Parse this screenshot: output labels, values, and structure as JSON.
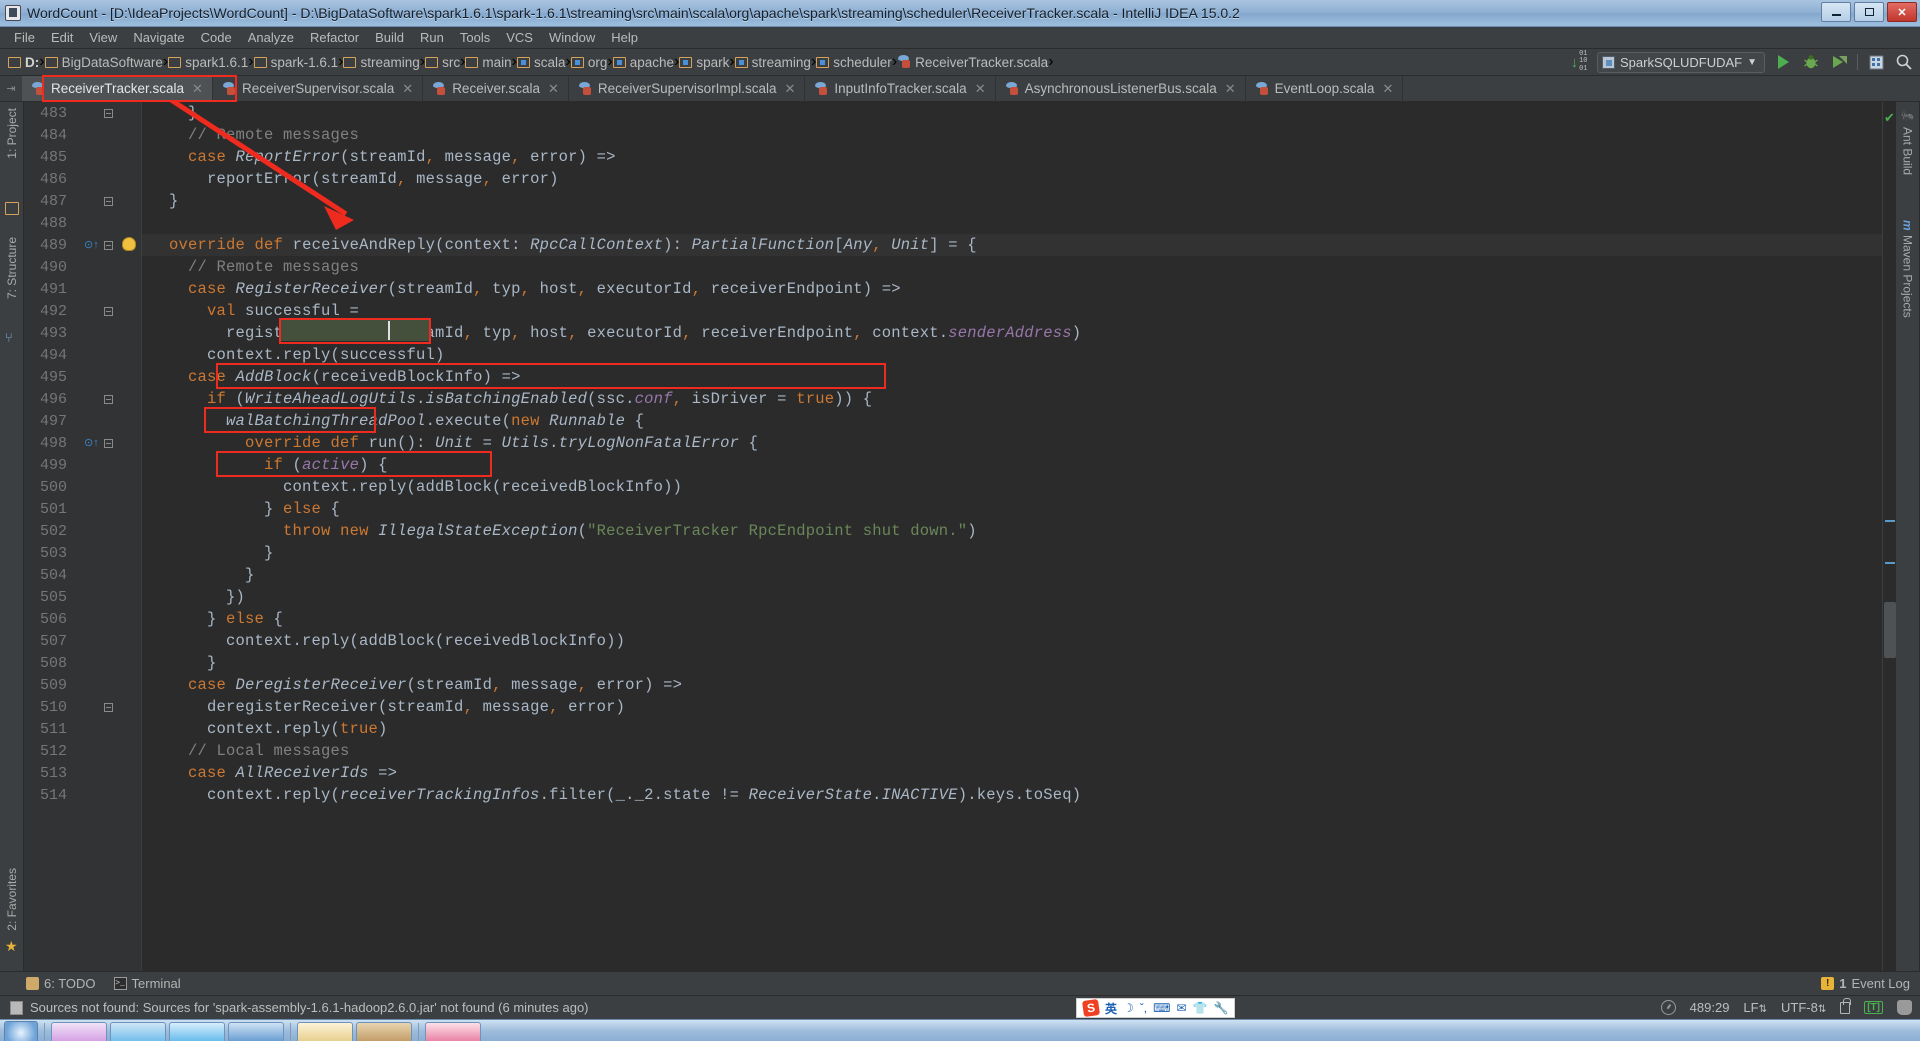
{
  "window": {
    "title": "WordCount - [D:\\IdeaProjects\\WordCount] - D:\\BigDataSoftware\\spark1.6.1\\spark-1.6.1\\streaming\\src\\main\\scala\\org\\apache\\spark\\streaming\\scheduler\\ReceiverTracker.scala - IntelliJ IDEA 15.0.2",
    "minimize": "_",
    "maximize": "❐",
    "close": "✕"
  },
  "menu": [
    "File",
    "Edit",
    "View",
    "Navigate",
    "Code",
    "Analyze",
    "Refactor",
    "Build",
    "Run",
    "Tools",
    "VCS",
    "Window",
    "Help"
  ],
  "breadcrumbs": [
    {
      "label": "D:",
      "icon": "folder-icon",
      "bold": true
    },
    {
      "label": "BigDataSoftware",
      "icon": "folder-icon",
      "bold": false
    },
    {
      "label": "spark1.6.1",
      "icon": "folder-icon",
      "bold": false
    },
    {
      "label": "spark-1.6.1",
      "icon": "folder-icon",
      "bold": false
    },
    {
      "label": "streaming",
      "icon": "folder-icon",
      "bold": false
    },
    {
      "label": "src",
      "icon": "folder-icon",
      "bold": false
    },
    {
      "label": "main",
      "icon": "folder-icon",
      "bold": false
    },
    {
      "label": "scala",
      "icon": "package-icon",
      "bold": false
    },
    {
      "label": "org",
      "icon": "package-icon",
      "bold": false
    },
    {
      "label": "apache",
      "icon": "package-icon",
      "bold": false
    },
    {
      "label": "spark",
      "icon": "package-icon",
      "bold": false
    },
    {
      "label": "streaming",
      "icon": "package-icon",
      "bold": false
    },
    {
      "label": "scheduler",
      "icon": "package-icon",
      "bold": false
    },
    {
      "label": "ReceiverTracker.scala",
      "icon": "scala-file-icon",
      "bold": false
    }
  ],
  "toolbar": {
    "run_config": "SparkSQLUDFUDAF",
    "dropdown_caret": "▼",
    "run_tooltip": "Run",
    "debug_tooltip": "Debug",
    "coverage_tooltip": "Run with Coverage",
    "digits": [
      "01",
      "10",
      "01"
    ]
  },
  "tabs": [
    {
      "label": "ReceiverTracker.scala",
      "active": true,
      "highlighted": true
    },
    {
      "label": "ReceiverSupervisor.scala",
      "active": false,
      "highlighted": false
    },
    {
      "label": "Receiver.scala",
      "active": false,
      "highlighted": false
    },
    {
      "label": "ReceiverSupervisorImpl.scala",
      "active": false,
      "highlighted": false
    },
    {
      "label": "InputInfoTracker.scala",
      "active": false,
      "highlighted": false
    },
    {
      "label": "AsynchronousListenerBus.scala",
      "active": false,
      "highlighted": false
    },
    {
      "label": "EventLoop.scala",
      "active": false,
      "highlighted": false
    }
  ],
  "tab_close_glyph": "✕",
  "left_tools": [
    {
      "label": "1: Project"
    },
    {
      "label": "7: Structure"
    },
    {
      "label": "2: Favorites"
    }
  ],
  "right_tools": [
    {
      "label": "Ant Build"
    },
    {
      "label": "Maven Projects"
    }
  ],
  "editor": {
    "first_line": 483,
    "lines": [
      {
        "n": 483,
        "text": "    }",
        "fold": true
      },
      {
        "n": 484,
        "text": "    // Remote messages",
        "comment": true
      },
      {
        "n": 485,
        "text": "    case ReportError(streamId, message, error) =>"
      },
      {
        "n": 486,
        "text": "      reportError(streamId, message, error)"
      },
      {
        "n": 487,
        "text": "  }",
        "fold": true
      },
      {
        "n": 488,
        "text": ""
      },
      {
        "n": 489,
        "text": "  override def receiveAndReply(context: RpcCallContext): PartialFunction[Any, Unit] = {",
        "fold": true,
        "override": true,
        "bulb": true,
        "caret": true
      },
      {
        "n": 490,
        "text": "    // Remote messages",
        "comment": true
      },
      {
        "n": 491,
        "text": "    case RegisterReceiver(streamId, typ, host, executorId, receiverEndpoint) =>"
      },
      {
        "n": 492,
        "text": "      val successful =",
        "fold": true
      },
      {
        "n": 493,
        "text": "        registerReceiver(streamId, typ, host, executorId, receiverEndpoint, context.senderAddress)"
      },
      {
        "n": 494,
        "text": "      context.reply(successful)"
      },
      {
        "n": 495,
        "text": "    case AddBlock(receivedBlockInfo) =>"
      },
      {
        "n": 496,
        "text": "      if (WriteAheadLogUtils.isBatchingEnabled(ssc.conf, isDriver = true)) {",
        "fold": true
      },
      {
        "n": 497,
        "text": "        walBatchingThreadPool.execute(new Runnable {"
      },
      {
        "n": 498,
        "text": "          override def run(): Unit = Utils.tryLogNonFatalError {",
        "fold": true,
        "override": true
      },
      {
        "n": 499,
        "text": "            if (active) {"
      },
      {
        "n": 500,
        "text": "              context.reply(addBlock(receivedBlockInfo))"
      },
      {
        "n": 501,
        "text": "            } else {"
      },
      {
        "n": 502,
        "text": "              throw new IllegalStateException(\"ReceiverTracker RpcEndpoint shut down.\")"
      },
      {
        "n": 503,
        "text": "            }"
      },
      {
        "n": 504,
        "text": "          }"
      },
      {
        "n": 505,
        "text": "        })"
      },
      {
        "n": 506,
        "text": "      } else {"
      },
      {
        "n": 507,
        "text": "        context.reply(addBlock(receivedBlockInfo))"
      },
      {
        "n": 508,
        "text": "      }"
      },
      {
        "n": 509,
        "text": "    case DeregisterReceiver(streamId, message, error) =>"
      },
      {
        "n": 510,
        "text": "      deregisterReceiver(streamId, message, error)",
        "fold": true
      },
      {
        "n": 511,
        "text": "      context.reply(true)"
      },
      {
        "n": 512,
        "text": "    // Local messages",
        "comment": true
      },
      {
        "n": 513,
        "text": "    case AllReceiverIds =>"
      },
      {
        "n": 514,
        "text": "      context.reply(receiverTrackingInfos.filter(_._2.state != ReceiverState.INACTIVE).keys.toSeq)"
      }
    ],
    "annotations": [
      {
        "name": "method-name-highlight",
        "target": "receiveAndReply"
      },
      {
        "name": "register-receiver-case-highlight",
        "target": "RegisterReceiver(streamId, typ, host, executorId, receiverEndpoint)"
      },
      {
        "name": "register-receiver-call-highlight",
        "target": "registerReceiver"
      },
      {
        "name": "addblock-case-highlight",
        "target": "AddBlock(receivedBlockInfo)"
      },
      {
        "name": "tab-highlight",
        "target": "ReceiverTracker.scala"
      }
    ]
  },
  "bottom_tools": [
    {
      "label": "6: TODO",
      "num": "6",
      "rest": ": TODO",
      "icon": "todo-icon"
    },
    {
      "label": "Terminal",
      "icon": "terminal-icon"
    }
  ],
  "event_log": {
    "count": "1",
    "label": "Event Log",
    "icon": "warning-icon"
  },
  "status": {
    "message": "Sources not found: Sources for 'spark-assembly-1.6.1-hadoop2.6.0.jar' not found (6 minutes ago)",
    "caret_position": "489:29",
    "line_separator": "LF",
    "encoding": "UTF-8",
    "line_sep_caret": "⇅",
    "encoding_caret": "⇅",
    "lock_state": "unlocked",
    "inspection_badge": "[T]"
  },
  "ime": {
    "logo": "S",
    "mode": "英",
    "items": [
      "☽",
      "ˇ,",
      "⌨",
      "✉",
      "👕",
      "🔧"
    ]
  },
  "colors": {
    "accent_red": "#ef2a1e",
    "editor_bg": "#2b2b2b",
    "gutter_bg": "#313335",
    "chrome_bg": "#3c3f41",
    "keyword": "#cc7832",
    "text": "#a9b7c6",
    "comment": "#808080",
    "string": "#6a8759",
    "field": "#9876aa",
    "number": "#6897bb",
    "titlebar_blue": "#8fb0d3"
  }
}
